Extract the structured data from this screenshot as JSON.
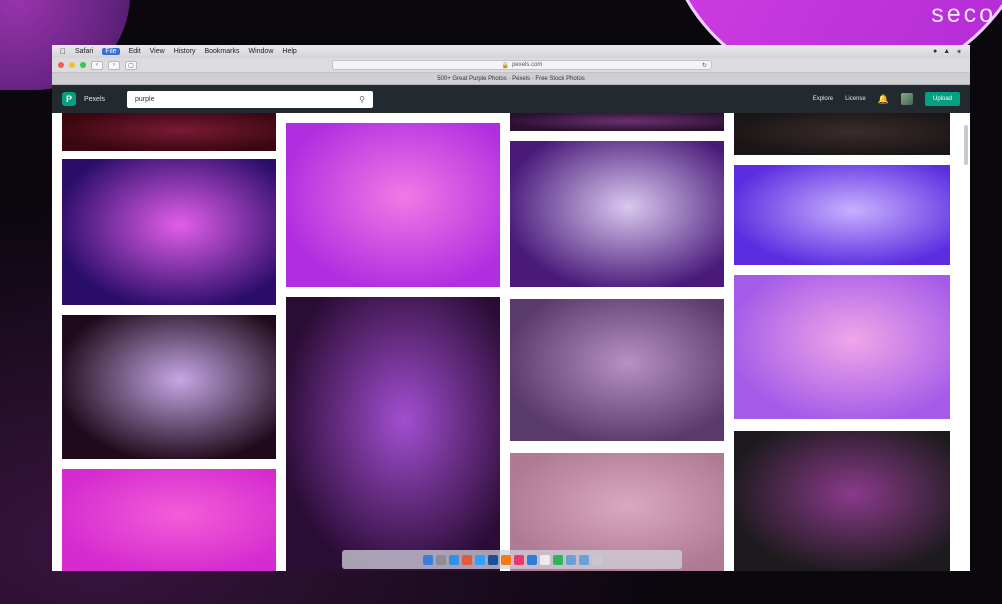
{
  "overlay": {
    "brand_word": "seco"
  },
  "menubar": {
    "items": [
      "Safari",
      "File",
      "Edit",
      "View",
      "History",
      "Bookmarks",
      "Window",
      "Help"
    ],
    "active_index": 1
  },
  "browser": {
    "address": "pexels.com",
    "tab_title": "500+ Great Purple Photos · Pexels · Free Stock Photos"
  },
  "site": {
    "logo_letter": "P",
    "logo_text": "Pexels",
    "search_value": "purple",
    "nav": {
      "explore": "Explore",
      "license": "License",
      "upload": "Upload"
    }
  },
  "gallery": {
    "photos": [
      {
        "name": "dark-red-strip",
        "c1": "#3a0710",
        "c2": "#7a1a36"
      },
      {
        "name": "purple-fiber-optic-lamp",
        "c1": "#2a0d6a",
        "c2": "#e25ee9"
      },
      {
        "name": "purple-daisy-flower",
        "c1": "#1e0a1a",
        "c2": "#c7a7e6"
      },
      {
        "name": "pink-petals",
        "c1": "#d62bcf",
        "c2": "#f25ed8"
      },
      {
        "name": "pink-smoke-abstract",
        "c1": "#b02de0",
        "c2": "#f07ae6"
      },
      {
        "name": "purple-phlox-flowers",
        "c1": "#2a0c35",
        "c2": "#a24ed0"
      },
      {
        "name": "dark-purple-strip",
        "c1": "#2a1030",
        "c2": "#6a3270"
      },
      {
        "name": "purple-balloons",
        "c1": "#4a1a7a",
        "c2": "#d9c8ef"
      },
      {
        "name": "allium-field",
        "c1": "#5a3a6a",
        "c2": "#b790c4"
      },
      {
        "name": "pink-wooden-wall-window",
        "c1": "#b07a94",
        "c2": "#d9a9bf"
      },
      {
        "name": "dark-wood-strip",
        "c1": "#1b1515",
        "c2": "#3a2c2c"
      },
      {
        "name": "purple-water-drop",
        "c1": "#5a2ee0",
        "c2": "#c9b0ff"
      },
      {
        "name": "pink-sky-birds",
        "c1": "#a55be8",
        "c2": "#f0a6e8"
      },
      {
        "name": "purple-chrysanthemum",
        "c1": "#1c1a1c",
        "c2": "#8a3a8a"
      }
    ]
  }
}
